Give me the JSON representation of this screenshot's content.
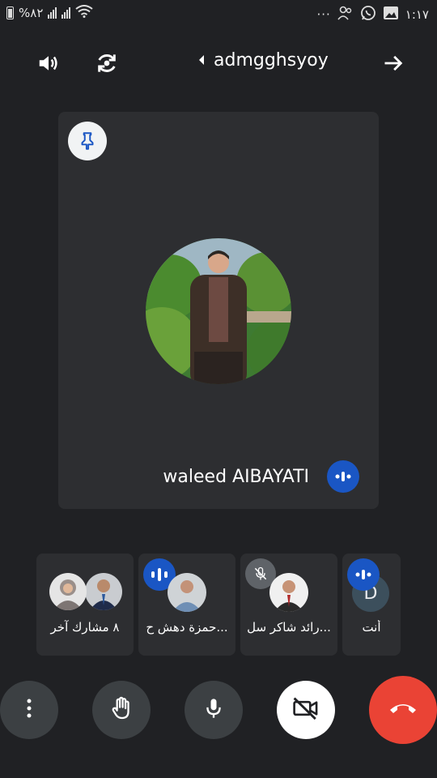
{
  "status_bar": {
    "battery_text": "%٨٢",
    "time": "١:١٧",
    "more_dots": "···"
  },
  "meeting": {
    "code": "admgghsyoy"
  },
  "main_speaker": {
    "name": "waleed AIBAYATI"
  },
  "participants": [
    {
      "label": "٨ مشارك آخر"
    },
    {
      "label": "حمزة دهش ح..."
    },
    {
      "label": "رائد شاكر سل..."
    },
    {
      "label": "أنت",
      "avatar_letter": "D"
    }
  ],
  "colors": {
    "background": "#202124",
    "tile": "#2d2e31",
    "speaking_badge": "#1a56c4",
    "end_call": "#ea4335"
  },
  "icons": {
    "volume": "volume-icon",
    "switch_camera": "switch-camera-icon",
    "arrow_right": "arrow-right-icon",
    "pin": "pin-icon",
    "more": "more-vert-icon",
    "raise_hand": "raise-hand-icon",
    "mic": "mic-icon",
    "camera_off": "camera-off-icon",
    "end_call": "end-call-icon"
  }
}
